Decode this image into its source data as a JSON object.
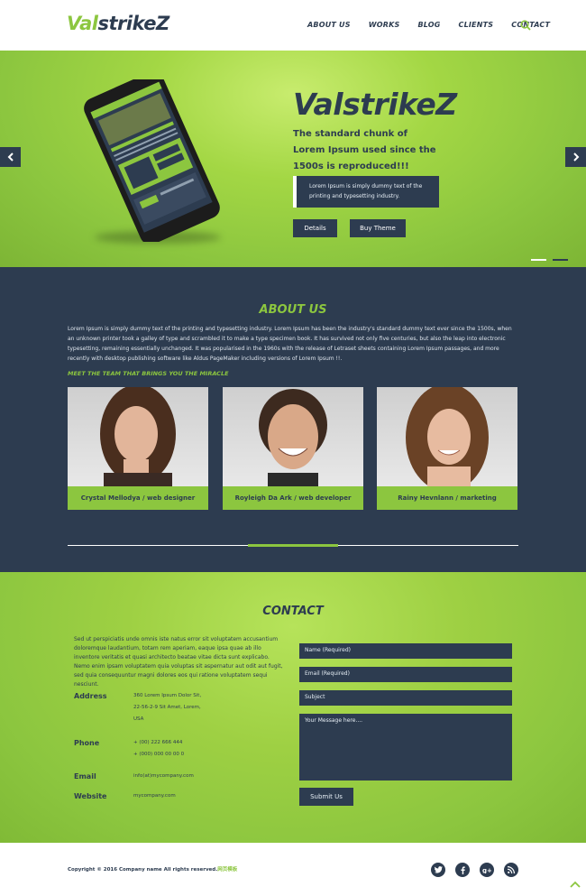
{
  "header": {
    "logo_part1": "Val",
    "logo_part2": "strikeZ",
    "nav": [
      "ABOUT US",
      "WORKS",
      "BLOG",
      "CLIENTS",
      "CONTACT"
    ]
  },
  "hero": {
    "title_part1": "Val",
    "title_part2": "strikeZ",
    "subtitle": "The standard chunk of Lorem Ipsum used since the 1500s is reproduced!!!",
    "box_text": "Lorem Ipsum is simply dummy text of the printing and typesetting industry.",
    "details_label": "Details",
    "buy_label": "Buy Theme"
  },
  "about": {
    "title": "ABOUT US",
    "text": "Lorem Ipsum is simply dummy text of the printing and typesetting industry. Lorem Ipsum has been the industry's standard dummy text ever since the 1500s, when an unknown printer took a galley of type and scrambled it to make a type specimen book. It has survived not only five centuries, but also the leap into electronic typesetting, remaining essentially unchanged. It was popularised in the 1960s with the release of Letraset sheets containing Lorem Ipsum passages, and more recently with desktop publishing software like Aldus PageMaker including versions of Lorem Ipsum !!.",
    "team_heading": "MEET THE TEAM THAT BRINGS YOU THE MIRACLE",
    "team": [
      {
        "caption": "Crystal Mellodya / web designer"
      },
      {
        "caption": "Royleigh Da Ark / web developer"
      },
      {
        "caption": "Rainy Hevnlann / marketing"
      }
    ]
  },
  "contact": {
    "title": "CONTACT",
    "text": "Sed ut perspiciatis unde omnis iste natus error sit voluptatem accusantium doloremque laudantium, totam rem aperiam, eaque ipsa quae ab illo inventore veritatis et quasi architecto beatae vitae dicta sunt explicabo. Nemo enim ipsam voluptatem quia voluptas sit aspernatur aut odit aut fugit, sed quia consequuntur magni dolores eos qui ratione voluptatem sequi nesciunt.",
    "address_label": "Address",
    "address_lines": [
      "360 Lorem Ipsum Dolor Sit,",
      "22-56-2-9 Sit Amet, Lorem,",
      "USA"
    ],
    "phone_label": "Phone",
    "phone_lines": [
      "+ (00) 222 666 444",
      "+ (000) 000 00 00 0"
    ],
    "email_label": "Email",
    "email_value": "info(at)mycompany.com",
    "website_label": "Website",
    "website_value": "mycompany.com",
    "fields": {
      "name": "Name (Required)",
      "email": "Email (Required)",
      "subject": "Subject",
      "message": "Your Message here...."
    },
    "submit_label": "Submit Us"
  },
  "footer": {
    "copyright": "Copyright © 2016 Company name All rights reserved.",
    "copyright_link": "网页模板"
  },
  "colors": {
    "navy": "#2d3c50",
    "green": "#8cc63f"
  }
}
